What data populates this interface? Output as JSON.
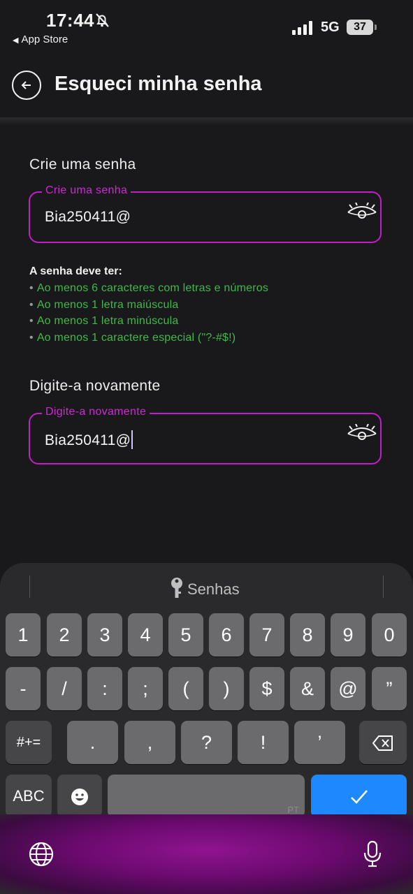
{
  "status_bar": {
    "time": "17:44",
    "back_label": "App Store",
    "network": "5G",
    "battery": "37"
  },
  "header": {
    "title": "Esqueci minha senha"
  },
  "password_section": {
    "title": "Crie uma senha",
    "field_label": "Crie uma senha",
    "value": "Bia250411@"
  },
  "requirements": {
    "title": "A senha deve ter:",
    "items": [
      "Ao menos 6 caracteres com letras e números",
      "Ao menos 1 letra maiúscula",
      "Ao menos 1 letra minúscula",
      "Ao menos 1 caractere especial (\"?-#$!)"
    ],
    "color": "#41b94a"
  },
  "confirm_section": {
    "title": "Digite-a novamente",
    "field_label": "Digite-a novamente",
    "value": "Bia250411@"
  },
  "keyboard": {
    "suggestion": "Senhas",
    "row1": [
      "1",
      "2",
      "3",
      "4",
      "5",
      "6",
      "7",
      "8",
      "9",
      "0"
    ],
    "row2": [
      "-",
      "/",
      ":",
      ";",
      "(",
      ")",
      "$",
      "&",
      "@",
      "”"
    ],
    "row3": [
      ".",
      ",",
      "?",
      "!",
      "’"
    ],
    "symbols_key": "#+=",
    "abc_key": "ABC",
    "space_lang": "PT",
    "return_icon": "checkmark-icon"
  },
  "colors": {
    "accent": "#c11fc8",
    "background": "#19181a",
    "return_key": "#1e88ff"
  }
}
